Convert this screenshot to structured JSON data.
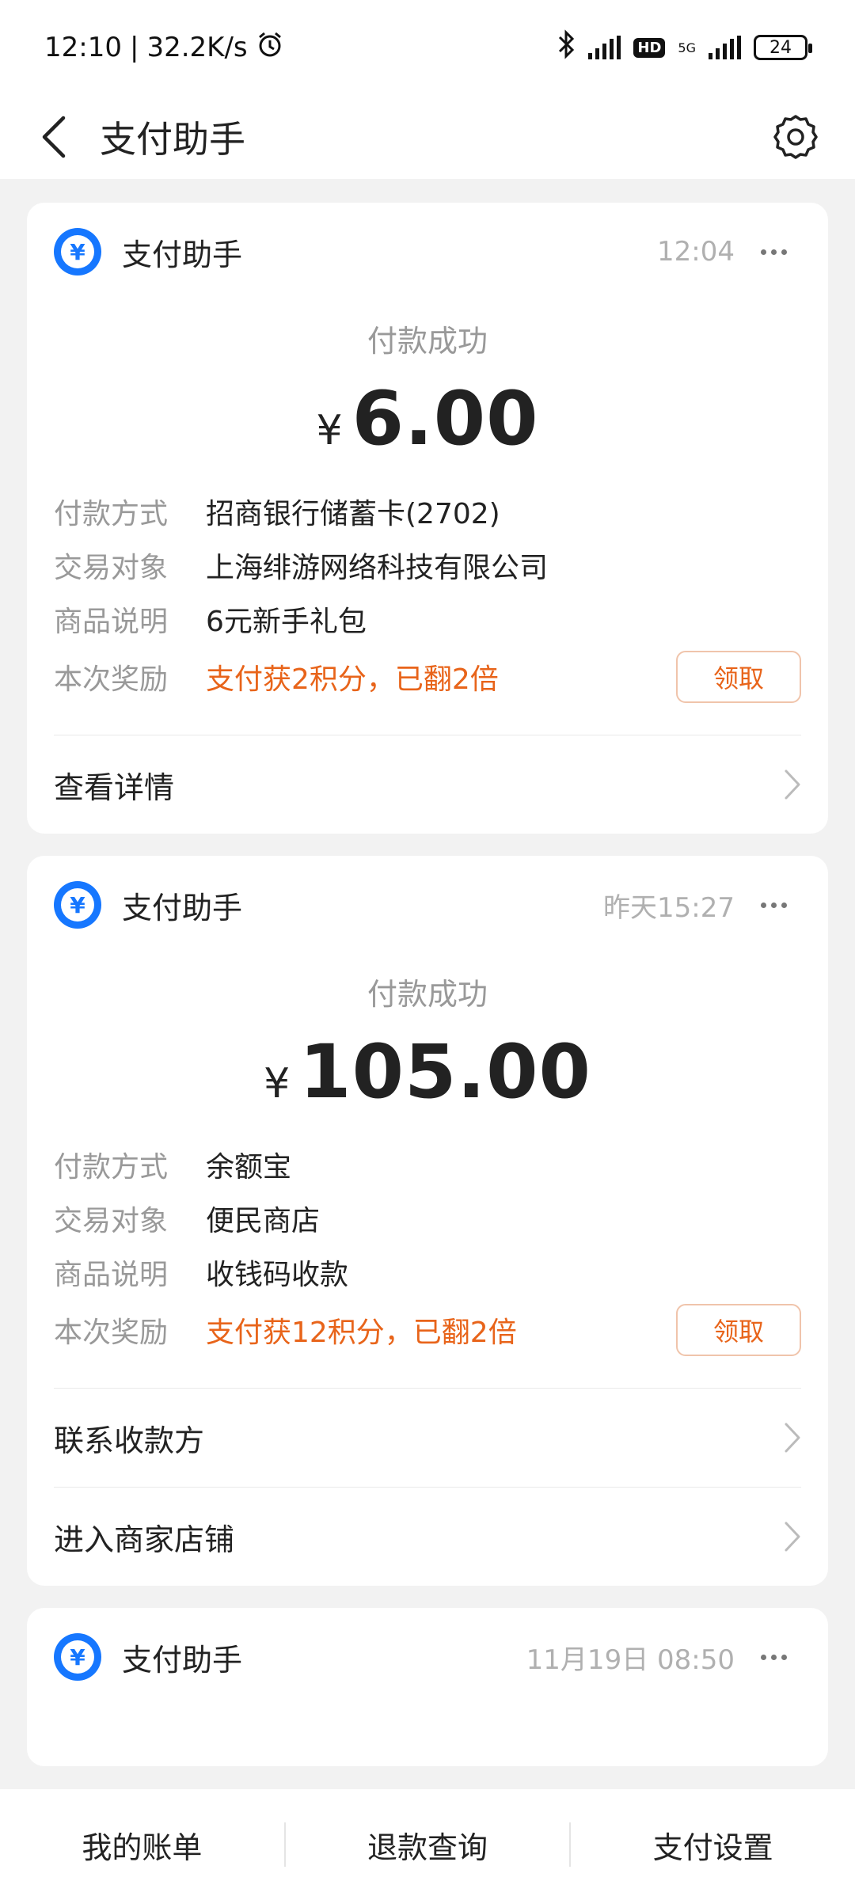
{
  "status_bar": {
    "time": "12:10",
    "network_speed": "32.2K/s",
    "hd_label": "HD",
    "net_type": "5G",
    "battery": "24"
  },
  "nav": {
    "title": "支付助手"
  },
  "cards": [
    {
      "app_name": "支付助手",
      "time": "12:04",
      "status": "付款成功",
      "currency": "¥",
      "amount": "6.00",
      "info": [
        {
          "label": "付款方式",
          "value": "招商银行储蓄卡(2702)"
        },
        {
          "label": "交易对象",
          "value": "上海绯游网络科技有限公司"
        },
        {
          "label": "商品说明",
          "value": "6元新手礼包"
        }
      ],
      "reward": {
        "label": "本次奖励",
        "value": "支付获2积分，已翻2倍",
        "button": "领取"
      },
      "links": [
        "查看详情"
      ]
    },
    {
      "app_name": "支付助手",
      "time": "昨天15:27",
      "status": "付款成功",
      "currency": "¥",
      "amount": "105.00",
      "info": [
        {
          "label": "付款方式",
          "value": "余额宝"
        },
        {
          "label": "交易对象",
          "value": "便民商店"
        },
        {
          "label": "商品说明",
          "value": "收钱码收款"
        }
      ],
      "reward": {
        "label": "本次奖励",
        "value": "支付获12积分，已翻2倍",
        "button": "领取"
      },
      "links": [
        "联系收款方",
        "进入商家店铺"
      ]
    },
    {
      "app_name": "支付助手",
      "time": "11月19日 08:50"
    }
  ],
  "tabs": [
    "我的账单",
    "退款查询",
    "支付设置"
  ],
  "colors": {
    "accent": "#1677ff",
    "reward": "#e8641a"
  }
}
